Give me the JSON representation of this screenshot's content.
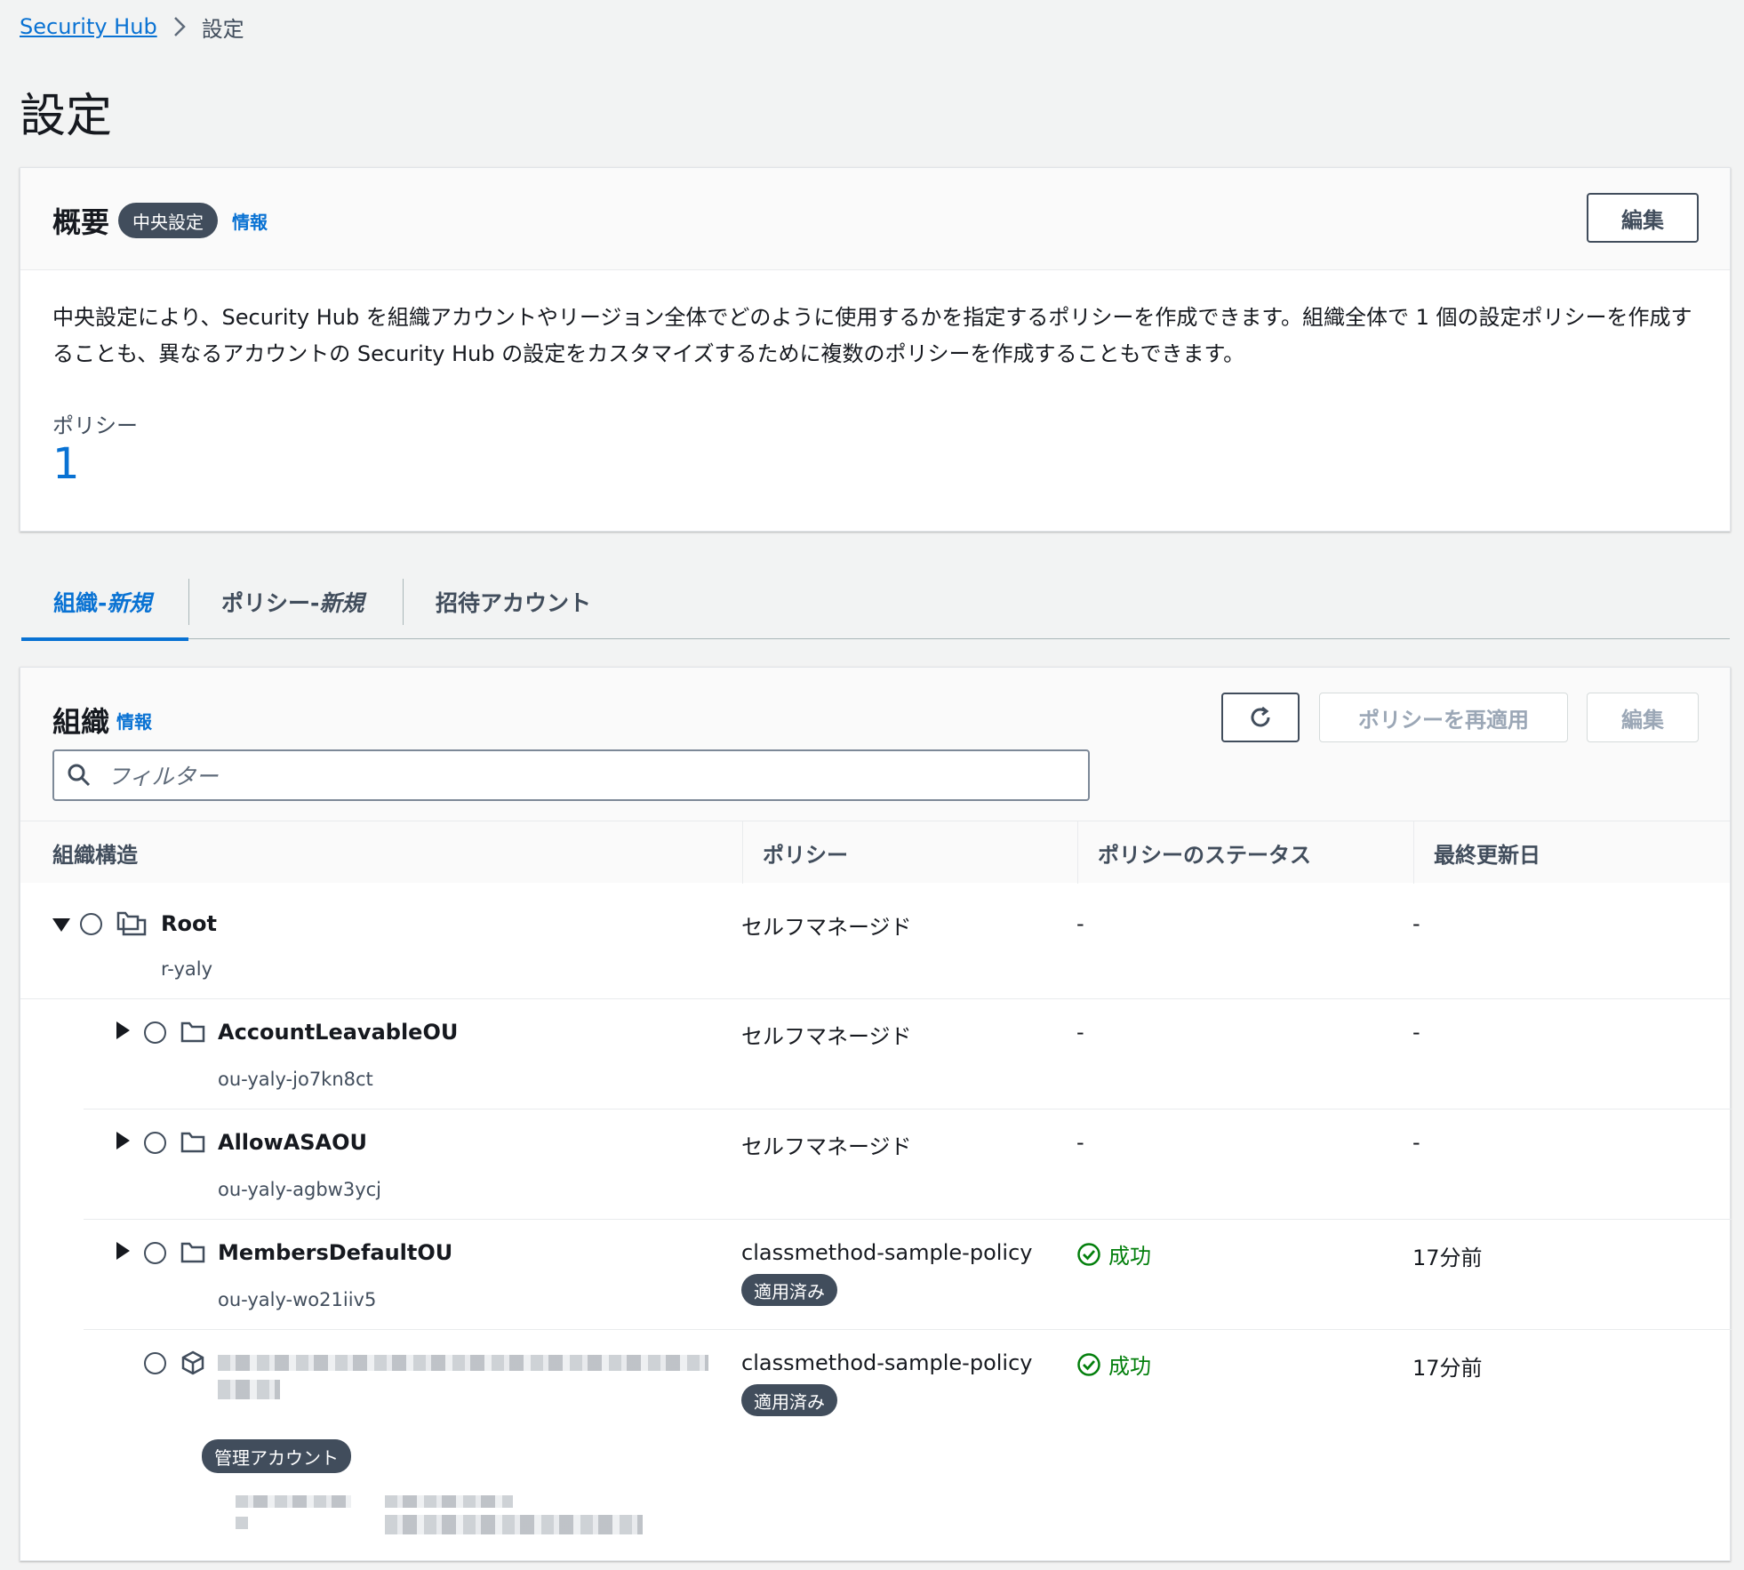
{
  "breadcrumb": {
    "root": "Security Hub",
    "current": "設定"
  },
  "page_title": "設定",
  "overview": {
    "title": "概要",
    "badge": "中央設定",
    "info": "情報",
    "edit_label": "編集",
    "description": "中央設定により、Security Hub を組織アカウントやリージョン全体でどのように使用するかを指定するポリシーを作成できます。組織全体で 1 個の設定ポリシーを作成することも、異なるアカウントの Security Hub の設定をカスタマイズするために複数のポリシーを作成することもできます。",
    "policy_label": "ポリシー",
    "policy_count": "1"
  },
  "tabs": [
    {
      "label": "組織- ",
      "suffix": "新規"
    },
    {
      "label": "ポリシー- ",
      "suffix": "新規"
    },
    {
      "label": "招待アカウント",
      "suffix": ""
    }
  ],
  "org": {
    "title": "組織",
    "info": "情報",
    "reapply_label": "ポリシーを再適用",
    "edit_label": "編集",
    "search_placeholder": "フィルター",
    "columns": [
      "組織構造",
      "ポリシー",
      "ポリシーのステータス",
      "最終更新日"
    ],
    "rows": [
      {
        "name": "Root",
        "id": "r-yaly",
        "policy": "セルフマネージド",
        "status": "-",
        "updated": "-"
      },
      {
        "name": "AccountLeavableOU",
        "id": "ou-yaly-jo7kn8ct",
        "policy": "セルフマネージド",
        "status": "-",
        "updated": "-"
      },
      {
        "name": "AllowASAOU",
        "id": "ou-yaly-agbw3ycj",
        "policy": "セルフマネージド",
        "status": "-",
        "updated": "-"
      },
      {
        "name": "MembersDefaultOU",
        "id": "ou-yaly-wo21iiv5",
        "policy": "classmethod-sample-policy",
        "policy_badge": "適用済み",
        "status": "成功",
        "updated": "17分前"
      },
      {
        "name": "",
        "id": "",
        "account_badge": "管理アカウント",
        "policy": "classmethod-sample-policy",
        "policy_badge": "適用済み",
        "status": "成功",
        "updated": "17分前"
      }
    ]
  },
  "colors": {
    "accent": "#0972d3",
    "success": "#037f0c",
    "badge": "#414d5c"
  }
}
